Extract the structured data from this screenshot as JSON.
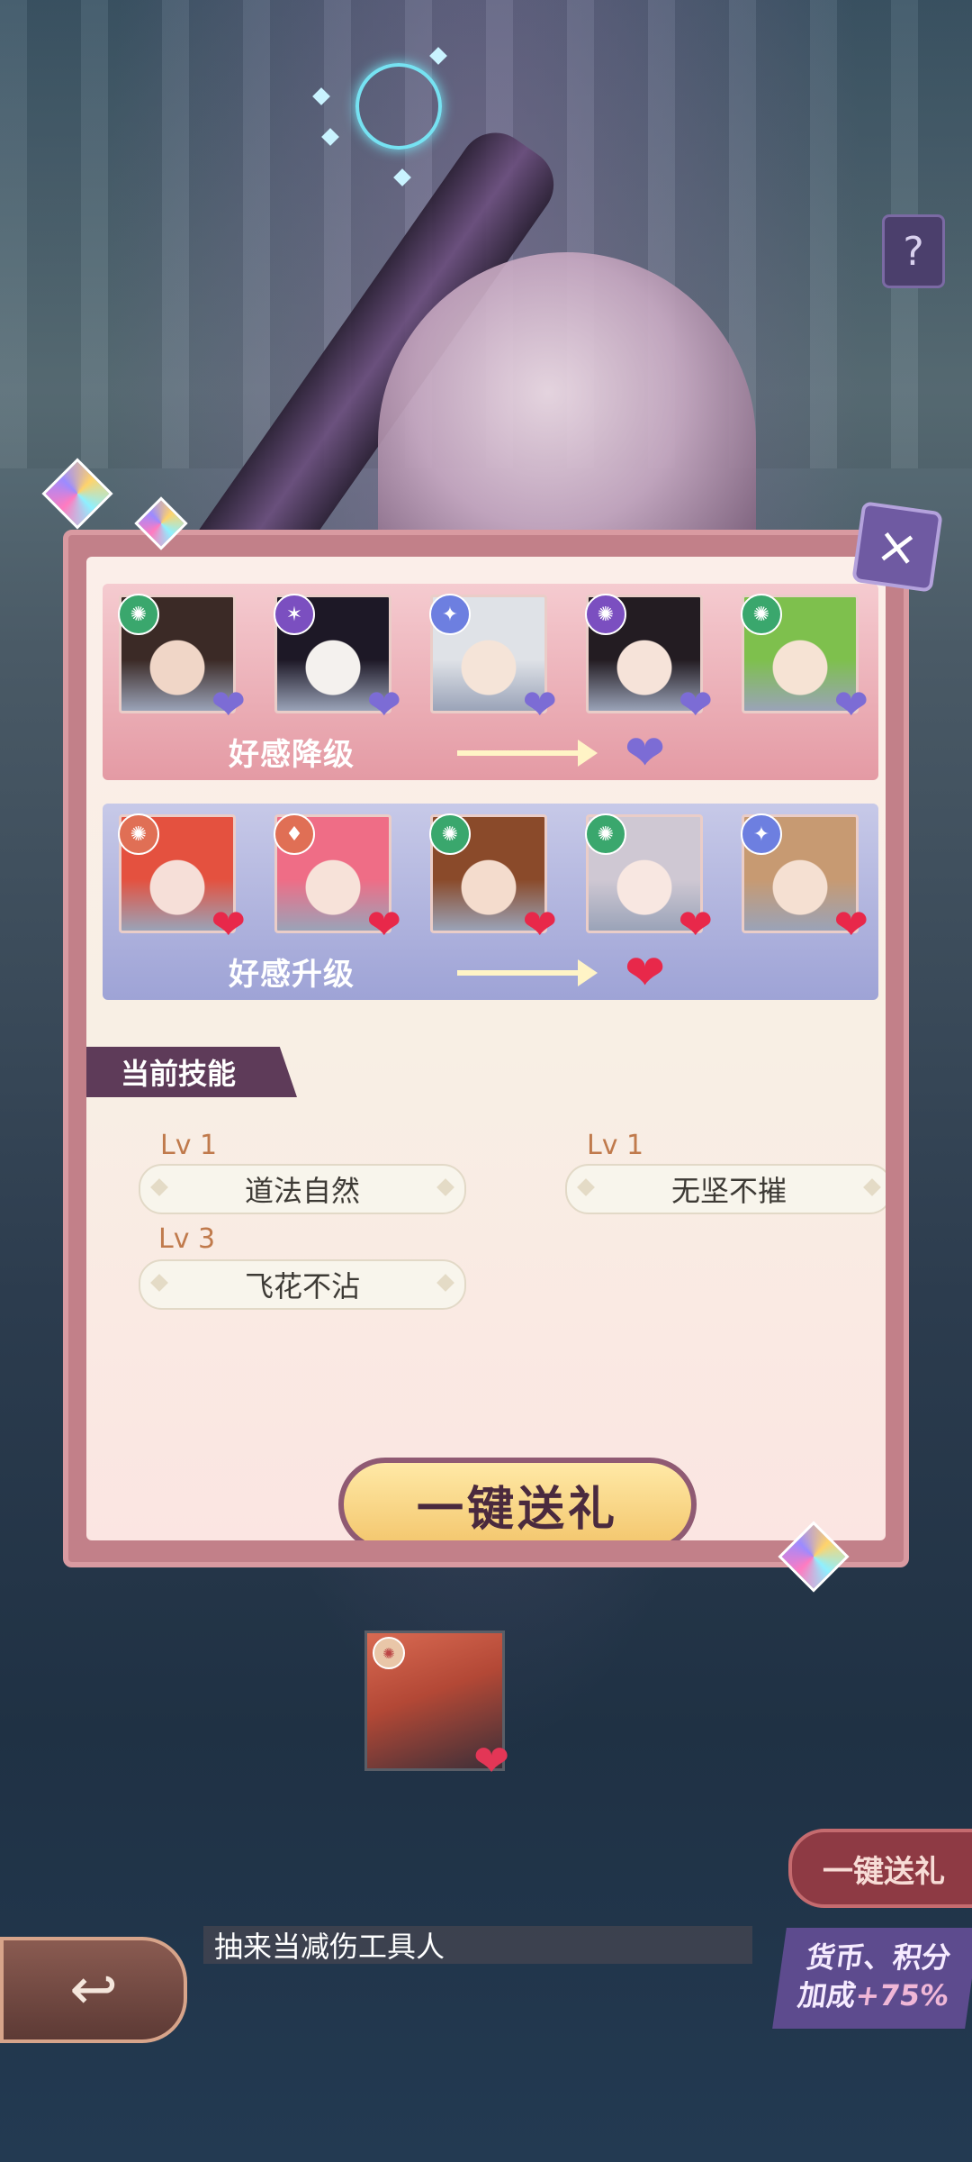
{
  "help_icon": "?",
  "close_icon": "×",
  "downgrade_band": {
    "label": "好感降级",
    "heart_color": "#7c6cd5",
    "characters": [
      {
        "faction_icon": "✺",
        "faction_color": "#3aa76d",
        "hair": "#3b2a26",
        "skin": "#f0d6c7"
      },
      {
        "faction_icon": "✶",
        "faction_color": "#7b4fc0",
        "hair": "#1d1826",
        "skin": "#f4f1ee"
      },
      {
        "faction_icon": "✦",
        "faction_color": "#6d7fe0",
        "hair": "#dfe2e7",
        "skin": "#f5e4d8"
      },
      {
        "faction_icon": "✺",
        "faction_color": "#7b4fc0",
        "hair": "#231c22",
        "skin": "#f6e3d9"
      },
      {
        "faction_icon": "✺",
        "faction_color": "#3aa76d",
        "hair": "#7ec04d",
        "skin": "#f6e3d4"
      }
    ]
  },
  "upgrade_band": {
    "label": "好感升级",
    "heart_color": "#e8284a",
    "characters": [
      {
        "faction_icon": "✺",
        "faction_color": "#e06f55",
        "hair": "#e4513f",
        "skin": "#f6dfd8"
      },
      {
        "faction_icon": "♦",
        "faction_color": "#e06f55",
        "hair": "#ef6d86",
        "skin": "#f7e2d9"
      },
      {
        "faction_icon": "✺",
        "faction_color": "#3aa76d",
        "hair": "#8a4a2a",
        "skin": "#f4dccd"
      },
      {
        "faction_icon": "✺",
        "faction_color": "#3aa76d",
        "hair": "#cfc8d3",
        "skin": "#f8e7e1"
      },
      {
        "faction_icon": "✦",
        "faction_color": "#6d7fe0",
        "hair": "#c79a72",
        "skin": "#f5e0d2"
      }
    ]
  },
  "skills_section": {
    "title": "当前技能",
    "skills": [
      {
        "level": "Lv 1",
        "name": "道法自然"
      },
      {
        "level": "Lv 1",
        "name": "无坚不摧"
      },
      {
        "level": "Lv 3",
        "name": "飞花不沾"
      }
    ]
  },
  "gift_button": "一键送礼",
  "side_gift_button": "一键送礼",
  "comment": "抽来当减伤工具人",
  "bonus": {
    "line1": "货币、积分",
    "line2": "加成",
    "pct": "+75%"
  },
  "back_icon": "↩"
}
